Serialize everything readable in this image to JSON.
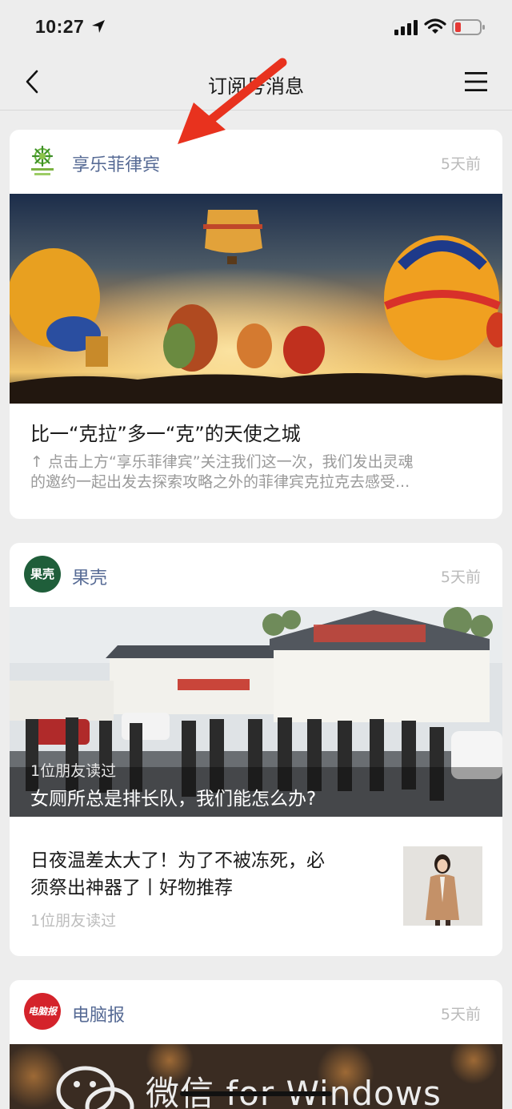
{
  "status_bar": {
    "time": "10:27"
  },
  "nav": {
    "title": "订阅号消息"
  },
  "cards": [
    {
      "account": "享乐菲律宾",
      "time": "5天前",
      "title": "比一“克拉”多一“克”的天使之城",
      "digest_line1": "↑ 点击上方“享乐菲律宾”关注我们这一次，我们发出灵魂",
      "digest_line2": "的邀约一起出发去探索攻略之外的菲律宾克拉克去感受..."
    },
    {
      "account": "果壳",
      "avatar_text": "果壳",
      "time": "5天前",
      "cover_read": "1位朋友读过",
      "cover_title": "女厕所总是排长队，我们能怎么办?",
      "sub_title_line1": "日夜温差太大了！为了不被冻死，必",
      "sub_title_line2": "须祭出神器了丨好物推荐",
      "sub_read": "1位朋友读过"
    },
    {
      "account": "电脑报",
      "avatar_text": "电脑报",
      "time": "5天前",
      "cover_text": "微信 for Windows"
    }
  ],
  "colors": {
    "link": "#576b95",
    "annotation": "#e8321e",
    "background": "#ededed"
  }
}
